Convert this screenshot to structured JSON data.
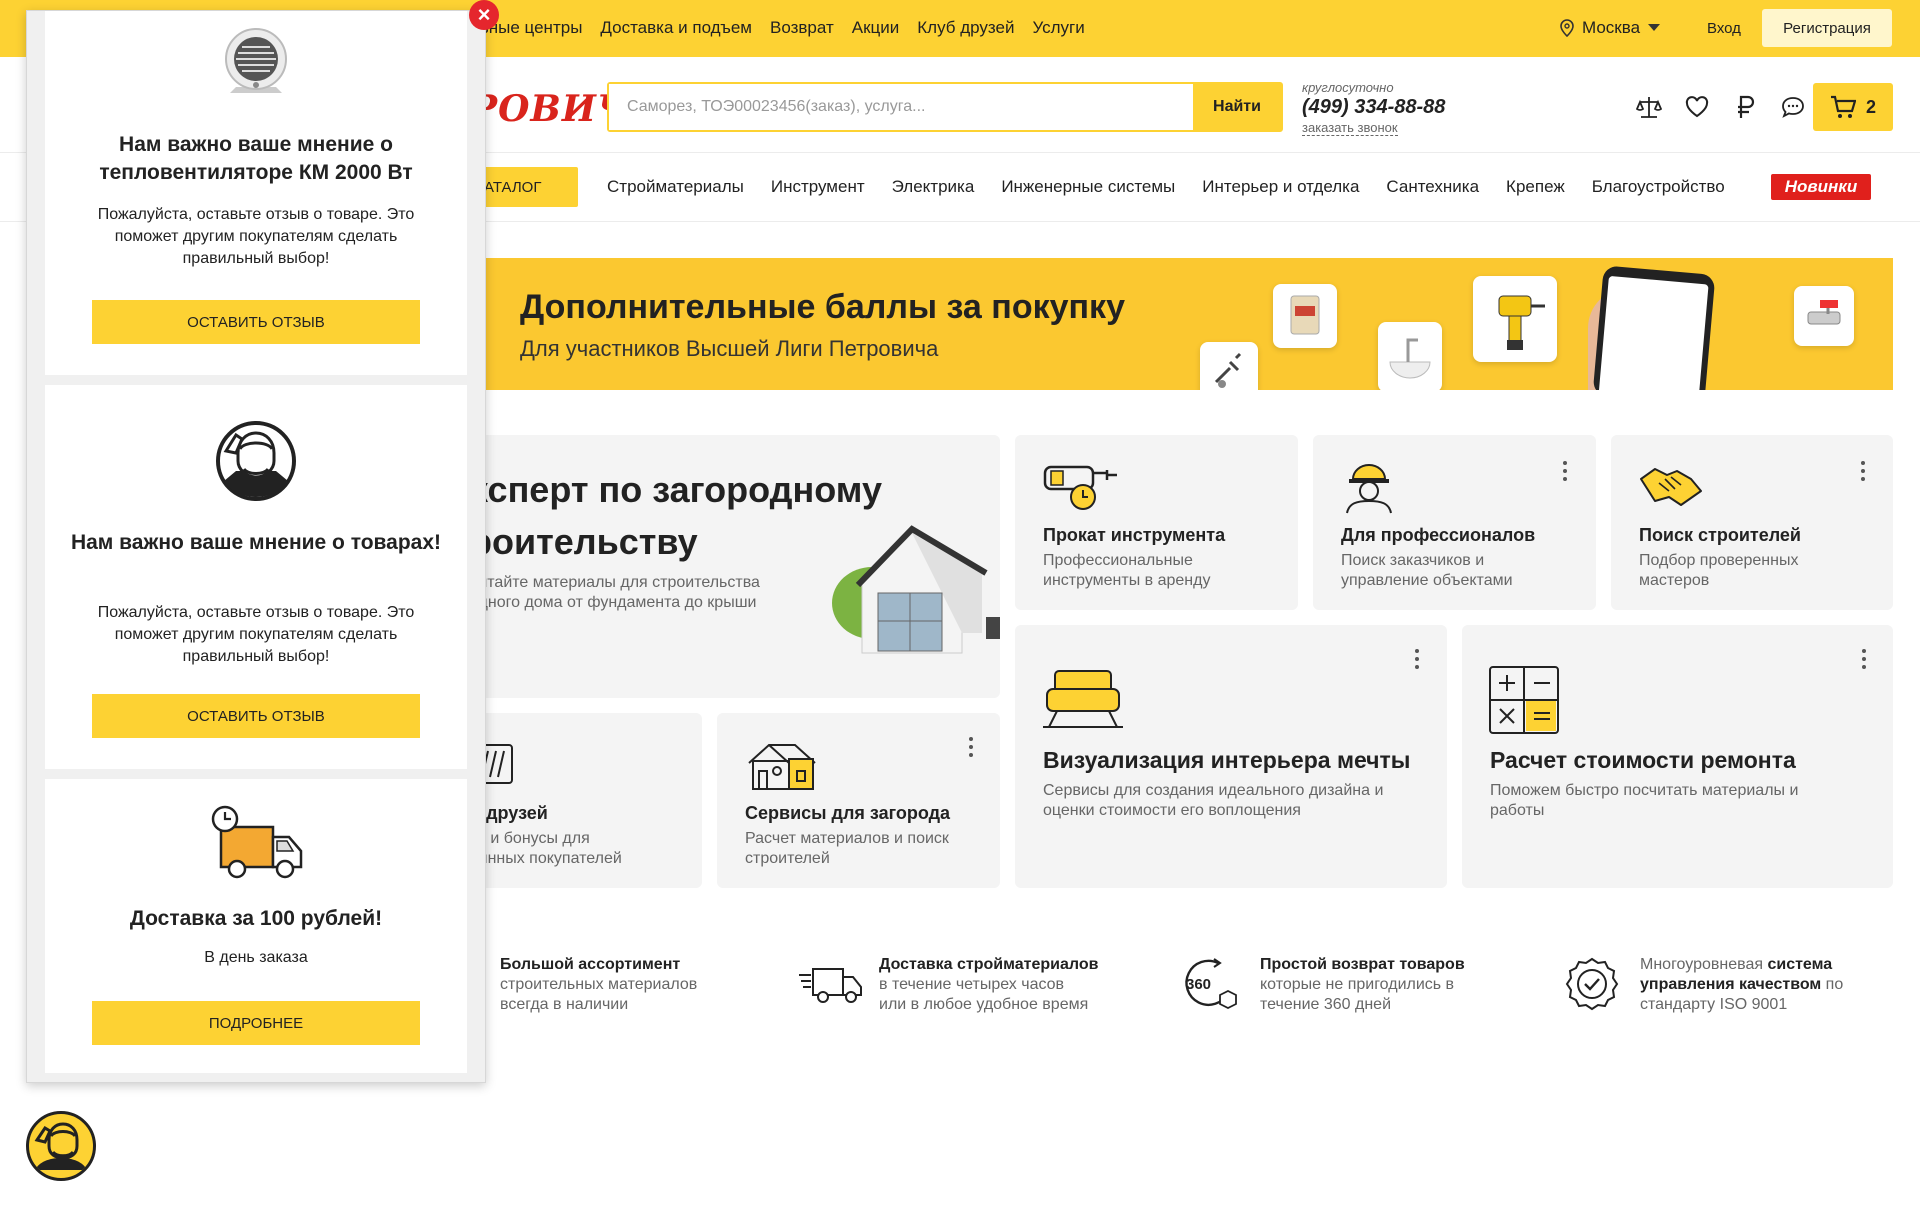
{
  "topbar": {
    "nav": [
      "льные центры",
      "Доставка и подъем",
      "Возврат",
      "Акции",
      "Клуб друзей",
      "Услуги"
    ],
    "city": "Москва",
    "login": "Вход",
    "register": "Регистрация"
  },
  "header": {
    "logo": "РОВИЧ",
    "search_placeholder": "Саморез, ТОЭ00023456(заказ), услуга...",
    "search_button": "Найти",
    "phone_hint": "круглосуточно",
    "phone": "(499) 334-88-88",
    "callback": "заказать звонок",
    "cart_count": "2"
  },
  "categories": {
    "catalog": "АТАЛОГ",
    "items": [
      "Стройматериалы",
      "Инструмент",
      "Электрика",
      "Инженерные системы",
      "Интерьер и отделка",
      "Сантехника",
      "Крепеж",
      "Благоустройство"
    ],
    "new": "Новинки"
  },
  "banner": {
    "title": "Дополнительные баллы за покупку",
    "subtitle": "Для участников Высшей Лиги Петровича"
  },
  "cards": {
    "expert": {
      "title_line1": "ксперт по загородному",
      "title_line2": "роительству",
      "desc_line1": "читайте материалы для строительства",
      "desc_line2": "одного дома от фундамента до крыши"
    },
    "rent": {
      "title": "Прокат инструмента",
      "desc_line1": "Профессиональные",
      "desc_line2": "инструменты в аренду"
    },
    "pro": {
      "title": "Для профессионалов",
      "desc_line1": "Поиск заказчиков и",
      "desc_line2": "управление объектами"
    },
    "builders": {
      "title": "Поиск строителей",
      "desc_line1": "Подбор проверенных",
      "desc_line2": "мастеров"
    },
    "friends": {
      "title": "б друзей",
      "desc_line1": "ки и бонусы для",
      "desc_line2": "оянных покупателей"
    },
    "country": {
      "title": "Сервисы для загорода",
      "desc_line1": "Расчет материалов и поиск",
      "desc_line2": "строителей"
    },
    "interior": {
      "title": "Визуализация интерьера мечты",
      "desc_line1": "Сервисы для создания идеального дизайна и",
      "desc_line2": "оценки стоимости его воплощения"
    },
    "calc": {
      "title": "Расчет стоимости ремонта",
      "desc_line1": "Поможем быстро посчитать материалы и",
      "desc_line2": "работы"
    }
  },
  "advantages": [
    {
      "title": "Большой ассортимент",
      "line1": "строительных материалов",
      "line2": "всегда в наличии"
    },
    {
      "title": "Доставка стройматериалов",
      "line1": "в течение четырех часов",
      "line2": "или в любое удобное время"
    },
    {
      "title": "Простой возврат товаров",
      "line1": "которые не пригодились в",
      "line2": "течение 360 дней"
    },
    {
      "pre": "Многоуровневая ",
      "bold1": "система",
      "bold2": "управления качеством",
      "post": " по",
      "line2": "стандарту ISO 9001"
    }
  ],
  "popup": {
    "card1": {
      "title": "Нам важно ваше мнение о тепловентиляторе КМ 2000 Вт",
      "text": "Пожалуйста, оставьте отзыв о товаре. Это поможет другим покупателям сделать правильный выбор!",
      "button": "Оставить отзыв"
    },
    "card2": {
      "title": "Нам важно ваше мнение о товарах!",
      "text": "Пожалуйста, оставьте отзыв о товаре. Это поможет другим покупателям сделать правильный выбор!",
      "button": "Оставить отзыв"
    },
    "card3": {
      "title": "Доставка за 100 рублей!",
      "text": "В день заказа",
      "button": "Подробнее"
    },
    "close": "×"
  },
  "icon_badge_360": "360",
  "colors": {
    "accent": "#fdd233",
    "red": "#e0201c"
  }
}
